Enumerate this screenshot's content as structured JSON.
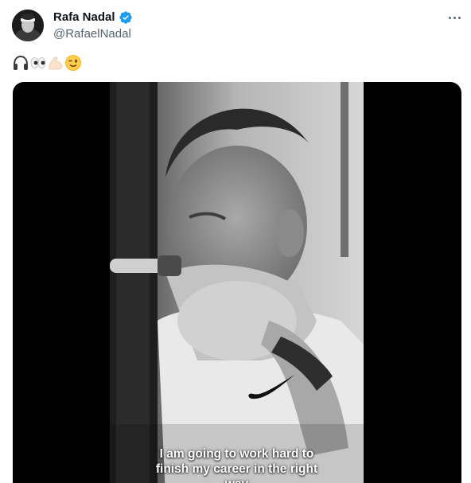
{
  "author": {
    "display_name": "Rafa Nadal",
    "handle": "@RafaelNadal",
    "avatar_icon": "profile-avatar",
    "verified_icon": "verified-badge-icon"
  },
  "menu": {
    "icon": "more-options-icon"
  },
  "tweet": {
    "emojis": [
      "headphones",
      "eyes",
      "flexed-biceps",
      "winking-face"
    ]
  },
  "media": {
    "type": "video",
    "caption_lines": [
      "I am going to work hard to",
      "finish my career in the right",
      "way"
    ]
  },
  "colors": {
    "text_primary": "#0f1419",
    "text_secondary": "#536471",
    "verified_blue": "#1d9bf0",
    "media_background": "#000000"
  }
}
